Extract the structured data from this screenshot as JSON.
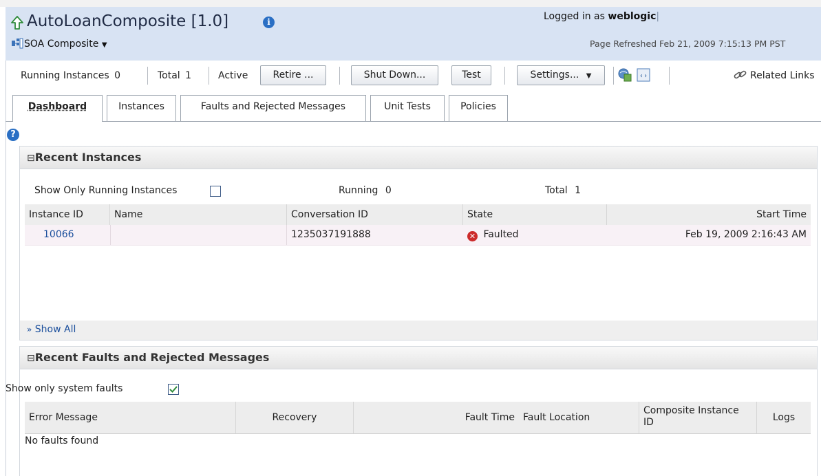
{
  "header": {
    "title": "AutoLoanComposite [1.0]",
    "home_icon": "up-arrow-icon",
    "info_icon": "info-icon",
    "composite_menu_label": "SOA Composite",
    "composite_icon": "composite-icon",
    "logged_in_prefix": "Logged in as",
    "logged_in_user": "weblogic",
    "page_refreshed": "Page Refreshed Feb 21, 2009 7:15:13 PM PST"
  },
  "toolbar": {
    "running_label": "Running Instances",
    "running_value": "0",
    "total_label": "Total",
    "total_value": "1",
    "active_label": "Active",
    "retire_button": "Retire ...",
    "shutdown_button": "Shut Down...",
    "test_button": "Test",
    "settings_button": "Settings...",
    "related_links": "Related Links"
  },
  "tabs": [
    {
      "label": "Dashboard"
    },
    {
      "label": "Instances"
    },
    {
      "label": "Faults and Rejected Messages"
    },
    {
      "label": "Unit Tests"
    },
    {
      "label": "Policies"
    }
  ],
  "recent_instances": {
    "title": "Recent Instances",
    "collapse_glyph": "⊟",
    "show_only_running_label": "Show Only Running Instances",
    "running_label": "Running",
    "running_value": "0",
    "total_label": "Total",
    "total_value": "1",
    "columns": [
      "Instance ID",
      "Name",
      "Conversation ID",
      "State",
      "Start Time"
    ],
    "rows": [
      {
        "instance_id": "10066",
        "name": "",
        "conversation_id": "1235037191888",
        "state": "Faulted",
        "start_time": "Feb 19, 2009 2:16:43 AM"
      }
    ],
    "show_all_label": "Show All"
  },
  "recent_faults": {
    "title": "Recent Faults and Rejected Messages",
    "collapse_glyph": "⊟",
    "show_only_system_label": "Show only system faults",
    "show_only_system_checked": true,
    "columns": [
      "Error Message",
      "Recovery",
      "Fault Time",
      "Fault Location",
      "Composite Instance ID",
      "Logs"
    ],
    "empty_text": "No faults found"
  },
  "colors": {
    "header_bg": "#d8e3f3",
    "link": "#1b4f9c",
    "fault_red": "#cc2b2b",
    "selected_row": "#f8f1f6"
  }
}
